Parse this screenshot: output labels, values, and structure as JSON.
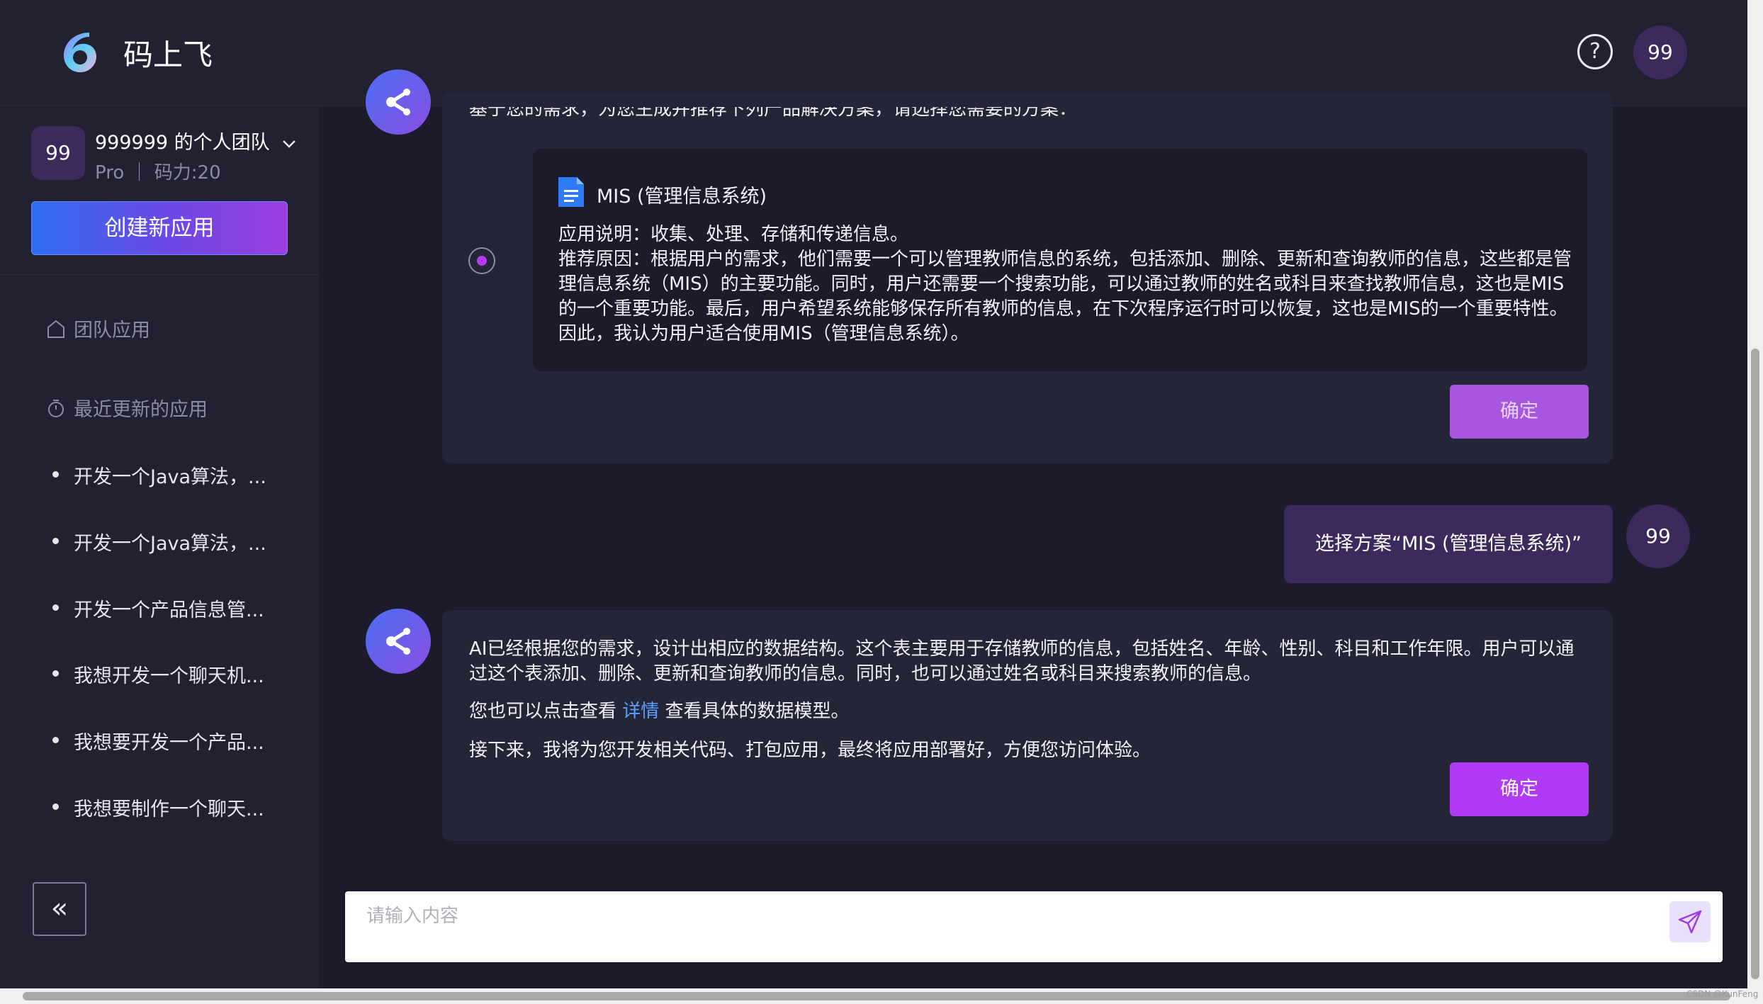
{
  "app": {
    "brand": "码上飞"
  },
  "header": {
    "help_label": "?",
    "user_avatar": "99"
  },
  "team": {
    "avatar": "99",
    "name": "999999 的个人团队",
    "meta": "Pro ｜ 码力:20"
  },
  "sidebar": {
    "create_label": "创建新应用",
    "team_apps_label": "团队应用",
    "recent_label": "最近更新的应用",
    "recent_items": [
      "开发一个Java算法，...",
      "开发一个Java算法，...",
      "开发一个产品信息管...",
      "我想开发一个聊天机...",
      "我想要开发一个产品...",
      "我想要制作一个聊天..."
    ],
    "collapse_label": "«"
  },
  "chat": {
    "msg1": {
      "intro": "基于您的需求，为您生成并推荐下列产品解决方案，请选择您需要的方案：",
      "plan_title": "MIS (管理信息系统)",
      "plan_desc": "应用说明：收集、处理、存储和传递信息。",
      "plan_reason": "推荐原因：根据用户的需求，他们需要一个可以管理教师信息的系统，包括添加、删除、更新和查询教师的信息，这些都是管理信息系统（MIS）的主要功能。同时，用户还需要一个搜索功能，可以通过教师的姓名或科目来查找教师信息，这也是MIS的一个重要功能。最后，用户希望系统能够保存所有教师的信息，在下次程序运行时可以恢复，这也是MIS的一个重要特性。因此，我认为用户适合使用MIS（管理信息系统）。",
      "confirm_label": "确定"
    },
    "user_msg": {
      "text": "选择方案“MIS (管理信息系统)”",
      "avatar": "99"
    },
    "msg2": {
      "para1": "AI已经根据您的需求，设计出相应的数据结构。这个表主要用于存储教师的信息，包括姓名、年龄、性别、科目和工作年限。用户可以通过这个表添加、删除、更新和查询教师的信息。同时，也可以通过姓名或科目来搜索教师的信息。",
      "para2_before": "您也可以点击查看 ",
      "para2_link": "详情",
      "para2_after": " 查看具体的数据模型。",
      "para3": "接下来，我将为您开发相关代码、打包应用，最终将应用部署好，方便您访问体验。",
      "confirm_label": "确定"
    }
  },
  "input": {
    "placeholder": "请输入内容",
    "value": ""
  },
  "watermark": "CSDN @KunFeng",
  "colors": {
    "accent": "#b13af5",
    "accent_disabled": "#a855e0",
    "link": "#5aa0ff",
    "bubble": "#3c2a5c"
  }
}
